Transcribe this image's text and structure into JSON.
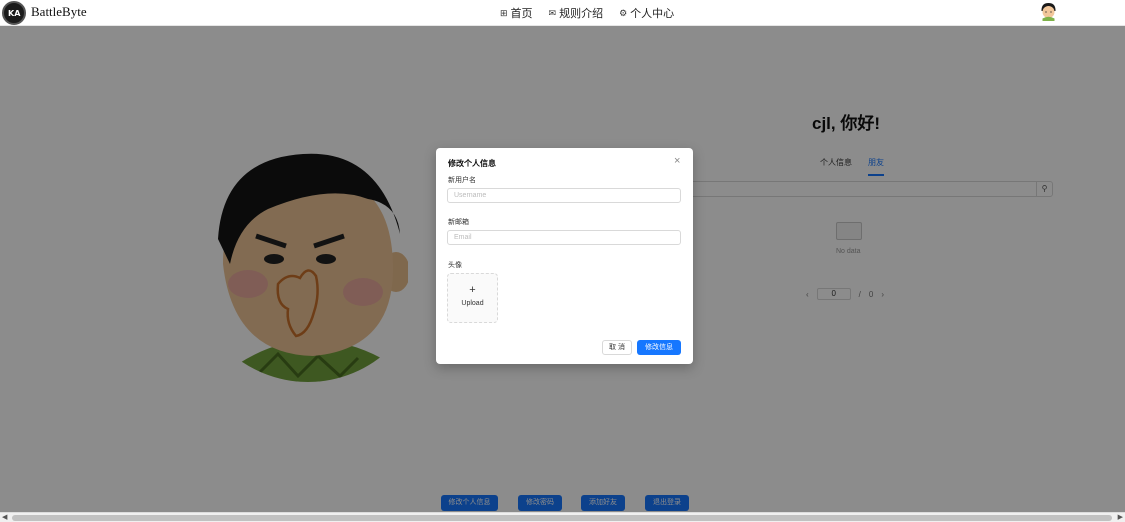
{
  "app": {
    "brand": "BattleByte",
    "logo_text": "KA"
  },
  "nav": {
    "items": [
      {
        "label": "首页",
        "icon": "grid-icon"
      },
      {
        "label": "规则介绍",
        "icon": "mail-icon"
      },
      {
        "label": "个人中心",
        "icon": "gear-icon"
      }
    ]
  },
  "profile": {
    "greeting": "cjl, 你好!",
    "tabs": [
      {
        "label": "个人信息",
        "active": false
      },
      {
        "label": "朋友",
        "active": true
      }
    ],
    "empty_text": "No data",
    "pager": {
      "current": "0",
      "separator": "/",
      "total": "0",
      "prev": "‹",
      "next": "›"
    }
  },
  "actions": {
    "edit_info": "修改个人信息",
    "change_password": "修改密码",
    "add_friend": "添加好友",
    "logout": "退出登录"
  },
  "modal": {
    "title": "修改个人信息",
    "close": "×",
    "username_label": "新用户名",
    "username_placeholder": "Username",
    "email_label": "新邮箱",
    "email_placeholder": "Email",
    "avatar_label": "头像",
    "upload_plus": "+",
    "upload_label": "Upload",
    "cancel": "取 消",
    "submit": "修改信息"
  },
  "colors": {
    "primary": "#1677ff",
    "mask": "rgba(0,0,0,0.45)"
  }
}
